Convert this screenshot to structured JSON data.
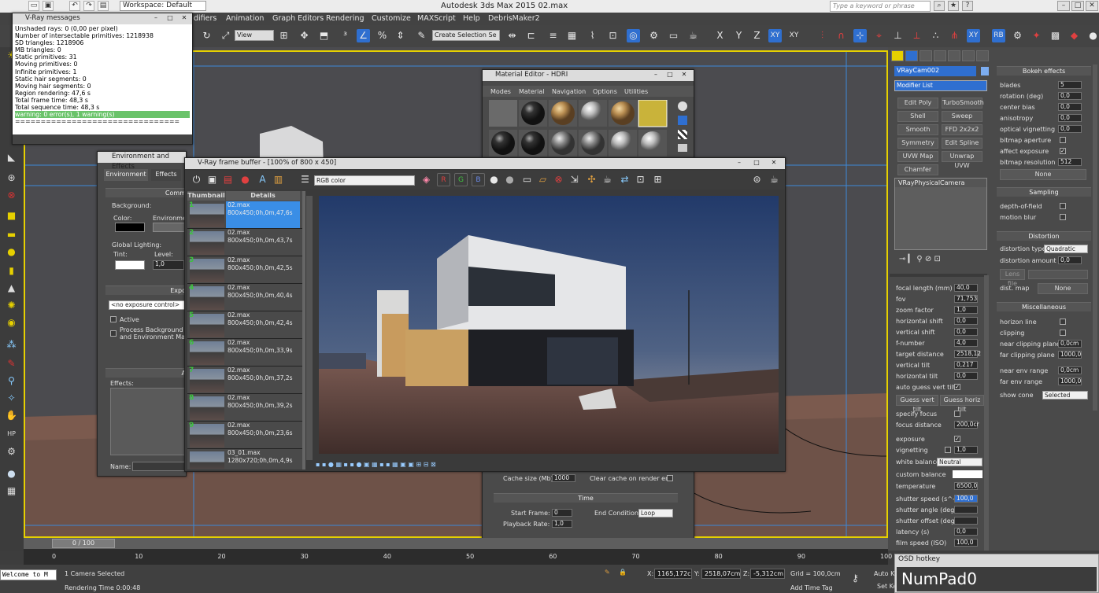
{
  "titlebar": {
    "workspace": "Workspace: Default",
    "app_title": "Autodesk 3ds Max 2015       02.max",
    "search_placeholder": "Type a keyword or phrase"
  },
  "menubar": [
    "difiers",
    "Animation",
    "Graph Editors",
    "Rendering",
    "Customize",
    "MAXScript",
    "Help",
    "DebrisMaker2"
  ],
  "toolbar": {
    "view_select": "View",
    "selection_set": "Create Selection Se",
    "axis_buttons": [
      "X",
      "Y",
      "Z",
      "XY",
      "XY"
    ]
  },
  "vray_messages": {
    "title": "V-Ray messages",
    "lines": [
      "Unshaded rays: 0 (0,00 per pixel)",
      "Number of intersectable primitives: 1218938",
      "  SD triangles: 1218906",
      "  MB triangles: 0",
      "  Static primitives: 31",
      "  Moving primitives: 0",
      "  Infinite primitives: 1",
      "  Static hair segments: 0",
      "  Moving hair segments: 0",
      "Region rendering: 47,6 s",
      "Total frame time: 48,3 s",
      "Total sequence time: 48,3 s"
    ],
    "warning": "warning: 0 error(s), 1 warning(s)",
    "separator": "================================"
  },
  "env_effects": {
    "title": "Environment and Effects",
    "tabs": [
      "Environment",
      "Effects"
    ],
    "common_header": "Comm",
    "background_label": "Background:",
    "color_label": "Color:",
    "environment_label": "Environmen",
    "global_lighting_label": "Global Lighting:",
    "tint_label": "Tint:",
    "level_label": "Level:",
    "level_value": "1,0",
    "exposure_header": "Expo",
    "exposure_control": "<no exposure control>",
    "active_label": "Active",
    "process_bg_label": "Process Background\nand Environment Maps",
    "atm_header": "A",
    "effects_label": "Effects:",
    "name_label": "Name:"
  },
  "material_editor": {
    "title": "Material Editor - HDRI",
    "menu": [
      "Modes",
      "Material",
      "Navigation",
      "Options",
      "Utilities"
    ]
  },
  "frame_buffer": {
    "title": "V-Ray frame buffer - [100% of 800 x 450]",
    "channel": "RGB color",
    "rgb": [
      "R",
      "G",
      "B"
    ],
    "columns": [
      "Thumbnail",
      "Details"
    ],
    "history": [
      {
        "num": "1",
        "name": "02.max",
        "details": "800x450;0h,0m,47,6s"
      },
      {
        "num": "2",
        "name": "02.max",
        "details": "800x450;0h,0m,43,7s"
      },
      {
        "num": "3",
        "name": "02.max",
        "details": "800x450;0h,0m,42,5s"
      },
      {
        "num": "4",
        "name": "02.max",
        "details": "800x450;0h,0m,40,4s"
      },
      {
        "num": "5",
        "name": "02.max",
        "details": "800x450;0h,0m,42,4s"
      },
      {
        "num": "6",
        "name": "02.max",
        "details": "800x450;0h,0m,33,9s"
      },
      {
        "num": "7",
        "name": "02.max",
        "details": "800x450;0h,0m,37,2s"
      },
      {
        "num": "8",
        "name": "02.max",
        "details": "800x450;0h,0m,39,2s"
      },
      {
        "num": "9",
        "name": "02.max",
        "details": "800x450;0h,0m,23,6s"
      },
      {
        "num": "",
        "name": "03_01.max",
        "details": "1280x720;0h,0m,4,9s"
      }
    ]
  },
  "anim_panel": {
    "cache_size_label": "Cache size (Mb):",
    "cache_size": "1000",
    "clear_cache_label": "Clear cache on render end",
    "time_header": "Time",
    "start_frame_label": "Start Frame:",
    "start_frame": "0",
    "playback_rate_label": "Playback Rate:",
    "playback_rate": "1,0",
    "end_condition_label": "End Condition:",
    "end_condition": "Loop"
  },
  "command_panel": {
    "object_name": "VRayCam002",
    "modifier_list": "Modifier List",
    "modifier_buttons": [
      [
        "Edit Poly",
        "TurboSmooth"
      ],
      [
        "Shell",
        "Sweep"
      ],
      [
        "Smooth",
        "FFD 2x2x2"
      ],
      [
        "Symmetry",
        "Edit Spline"
      ],
      [
        "UVW Map",
        "Unwrap UVW"
      ],
      [
        "Chamfer",
        ""
      ]
    ],
    "stack_item": "VRayPhysicalCamera",
    "params": [
      {
        "label": "focal length (mm)",
        "value": "40,0"
      },
      {
        "label": "fov",
        "value": "71,753"
      },
      {
        "label": "zoom factor",
        "value": "1,0"
      },
      {
        "label": "horizontal shift",
        "value": "0,0"
      },
      {
        "label": "vertical shift",
        "value": "0,0"
      },
      {
        "label": "f-number",
        "value": "4,0"
      },
      {
        "label": "target distance",
        "value": "2518,12"
      },
      {
        "label": "vertical tilt",
        "value": "0,217"
      },
      {
        "label": "horizontal tilt",
        "value": "0,0"
      }
    ],
    "auto_guess_label": "auto guess vert tilt",
    "guess_vert": "Guess vert tilt",
    "guess_horiz": "Guess horiz tilt",
    "specify_focus": "specify focus",
    "focus_distance_label": "focus distance",
    "focus_distance": "200,0cr",
    "exposure_label": "exposure",
    "vignetting_label": "vignetting",
    "vignetting": "1,0",
    "white_balance_label": "white balance",
    "white_balance": "Neutral",
    "custom_balance_label": "custom balance",
    "temperature_label": "temperature",
    "temperature": "6500,0",
    "shutter_speed_label": "shutter speed (s^-1",
    "shutter_speed": "100,0",
    "shutter_angle_label": "shutter angle (deg)",
    "shutter_offset_label": "shutter offset (deg)",
    "latency_label": "latency (s)",
    "latency": "0,0",
    "film_speed_label": "film speed (ISO)",
    "film_speed": "100,0"
  },
  "command_panel2": {
    "bokeh_header": "Bokeh effects",
    "bokeh": [
      {
        "label": "blades",
        "value": "5"
      },
      {
        "label": "rotation (deg)",
        "value": "0,0"
      },
      {
        "label": "center bias",
        "value": "0,0"
      },
      {
        "label": "anisotropy",
        "value": "0,0"
      },
      {
        "label": "optical vignetting",
        "value": "0,0"
      }
    ],
    "bitmap_aperture": "bitmap aperture",
    "affect_exposure": "affect exposure",
    "bitmap_resolution_label": "bitmap resolution",
    "bitmap_resolution": "512",
    "none_btn": "None",
    "sampling_header": "Sampling",
    "depth_of_field": "depth-of-field",
    "motion_blur": "motion blur",
    "distortion_header": "Distortion",
    "distortion_type_label": "distortion type",
    "distortion_type": "Quadratic",
    "distortion_amount_label": "distortion amount",
    "distortion_amount": "0,0",
    "lens_file": "Lens file",
    "dist_map_label": "dist. map",
    "dist_map": "None",
    "misc_header": "Miscellaneous",
    "horizon_line": "horizon line",
    "clipping": "clipping",
    "near_clip_label": "near clipping plane",
    "near_clip": "0,0cm",
    "far_clip_label": "far clipping plane",
    "far_clip": "1000,0",
    "near_env_label": "near env range",
    "near_env": "0,0cm",
    "far_env_label": "far env range",
    "far_env": "1000,0",
    "show_cone_label": "show cone",
    "show_cone": "Selected"
  },
  "timeline": {
    "frame": "0 / 100",
    "ticks": [
      "0",
      "10",
      "20",
      "30",
      "40",
      "50",
      "60",
      "70",
      "80",
      "90",
      "100"
    ]
  },
  "status": {
    "selection": "1 Camera Selected",
    "render_time": "Rendering Time  0:00:48",
    "x_label": "X:",
    "x": "1165,172c",
    "y_label": "Y:",
    "y": "2518,07cm",
    "z_label": "Z:",
    "z": "-5,312cm",
    "grid": "Grid = 100,0cm",
    "add_time_tag": "Add Time Tag",
    "auto_key": "Auto Ke",
    "set_key": "Set Ke",
    "welcome": "Welcome to M"
  },
  "osd": {
    "title": "OSD hotkey",
    "key": "NumPad0"
  }
}
